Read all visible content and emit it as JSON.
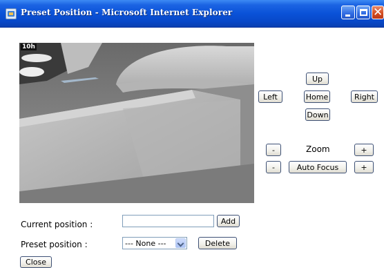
{
  "window": {
    "title": "Preset Position - Microsoft Internet Explorer",
    "icon": "ie-window-icon",
    "controls": [
      "minimize-icon",
      "maximize-icon",
      "close-icon"
    ]
  },
  "video": {
    "overlay_text": "10h"
  },
  "ptz": {
    "up": "Up",
    "left": "Left",
    "home": "Home",
    "right": "Right",
    "down": "Down"
  },
  "zoom": {
    "minus": "-",
    "label": "Zoom",
    "plus": "+"
  },
  "focus": {
    "minus": "-",
    "label": "Auto Focus",
    "plus": "+"
  },
  "current_position": {
    "label": "Current position :",
    "value": "",
    "add_label": "Add"
  },
  "preset_position": {
    "label": "Preset position :",
    "selected": "--- None ---",
    "delete_label": "Delete"
  },
  "close_label": "Close"
}
